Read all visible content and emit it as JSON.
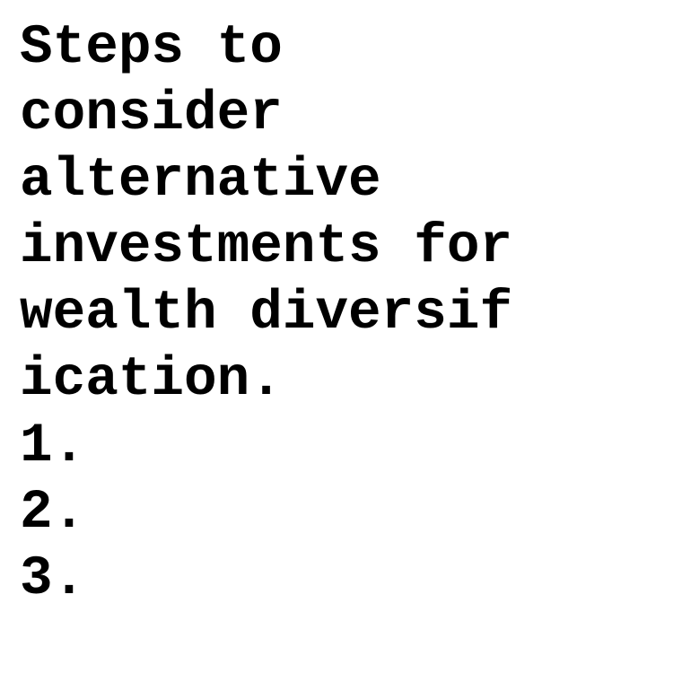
{
  "document": {
    "title_lines": [
      "Steps to",
      "consider",
      "alternative",
      "investments for",
      "wealth diversif",
      "ication."
    ],
    "list_items": [
      "1.",
      "2.",
      "3."
    ]
  },
  "colors": {
    "text": "#000000",
    "background": "#ffffff"
  }
}
